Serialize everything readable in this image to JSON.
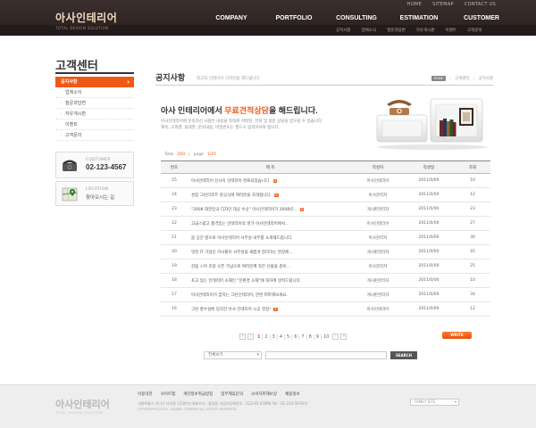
{
  "header": {
    "top_links": [
      "HOME",
      "SITEMAP",
      "CONTACT US"
    ],
    "logo": "아사인테리어",
    "logo_sub": "TOTAL DESIGN SOLUTION",
    "gnb": [
      "COMPANY",
      "PORTFOLIO",
      "CONSULTING",
      "ESTIMATION",
      "CUSTOMER"
    ],
    "subnav": [
      "공지사항",
      "업체소식",
      "질문과답변",
      "자유게시판",
      "이벤트",
      "고객문의"
    ]
  },
  "sidebar": {
    "title": "고객센터",
    "items": [
      {
        "label": "공지사항",
        "active": true
      },
      {
        "label": "업체소식",
        "active": false
      },
      {
        "label": "질문과답변",
        "active": false
      },
      {
        "label": "자유게시판",
        "active": false
      },
      {
        "label": "이벤트",
        "active": false
      },
      {
        "label": "고객문의",
        "active": false
      }
    ],
    "cs_label": "CUSTOMER",
    "cs_number": "02-123-4567",
    "location_label": "LOCATION",
    "location_text": "찾아오시는 길"
  },
  "main": {
    "page_title": "공지사항",
    "page_desc": "최고의 인테리어 디자인을 해드립니다.",
    "breadcrumb": [
      "HOME",
      "고객센터",
      "공지사항"
    ],
    "headline_pre": "아사 인테리어에서 ",
    "headline_hl": "무료견적상담",
    "headline_post": "을 해드립니다.",
    "intro_line1": "아사인테리어에 문의하신 사항은 내용을 토대로 어떠일, 전화 및 방문 상담을 받으실 수 있습니다.",
    "intro_line2": "제목, 고객명, 휴대폰, 문의내용, 비밀번호는 필드시 입력하셔야 합니다.",
    "total_label": "Total",
    "total_value": "200",
    "page_label": "page",
    "page_value": "1/25",
    "table": {
      "headers": [
        "번호",
        "제 목",
        "작성자",
        "작성일",
        "조회"
      ],
      "rows": [
        {
          "no": "25",
          "title": "아사인테리어 신사옥 인테리어 완료되었습니다.",
          "new": "N",
          "author": "아사인테리어",
          "date": "2011/0/00",
          "views": "10"
        },
        {
          "no": "24",
          "title": "성장 그린리조트 준공식에 여러분을 초대합니다.",
          "new": "N",
          "author": "아사관리자",
          "date": "2011/0/00",
          "views": "12"
        },
        {
          "no": "23",
          "title": "\"2008 대한민국 디자인 대상 수상\" 아사인테리어가 2008년...",
          "new": "N",
          "author": "게시판관리자",
          "date": "2011/0/00",
          "views": "23"
        },
        {
          "no": "22",
          "title": "고급스럽고 품격있는 인테리어의 명가 아사인테리어에서...",
          "new": "",
          "author": "아사인테리어",
          "date": "2011/0/00",
          "views": "27"
        },
        {
          "no": "21",
          "title": "봄 공간 향으로 아사인테리어 사무실 내부를 소개해드립니다.",
          "new": "",
          "author": "아사관리자",
          "date": "2011/0/00",
          "views": "30"
        },
        {
          "no": "20",
          "title": "멋진 IT 기업인 아사를이 사무실을 새롭게 정리하는 현장에...",
          "new": "",
          "author": "게시판관리자",
          "date": "2011/0/00",
          "views": "45"
        },
        {
          "no": "19",
          "title": "감립 스마 조랑 오픈 가넘으로 여러분께 작은 선물을 준비...",
          "new": "",
          "author": "아사관리자",
          "date": "2011/0/00",
          "views": "25"
        },
        {
          "no": "18",
          "title": "포고 있는 인테리어 소재인 \"친환경 소재\"에 대하여 알려드립니다.",
          "new": "",
          "author": "게시판관리자",
          "date": "2011/0/00",
          "views": "10"
        },
        {
          "no": "17",
          "title": "아사인테리어가 꿈하는 그런인테리어, 한번 피파해보세요.",
          "new": "",
          "author": "게시판관리자",
          "date": "2011/0/00",
          "views": "34"
        },
        {
          "no": "16",
          "title": "그런 풍수설에 입각한 아사 인테리어 시공 현장!",
          "new": "N",
          "author": "아사인테리어",
          "date": "2011/0/00",
          "views": "12"
        }
      ]
    },
    "pagination": {
      "prev_first": "«",
      "prev": "‹",
      "pages": [
        "1",
        "2",
        "3",
        "4",
        "5",
        "6",
        "7",
        "8",
        "9",
        "10"
      ],
      "current": "1",
      "next": "›",
      "next_last": "»"
    },
    "write_button": "WRITE",
    "search": {
      "select_value": "전체보기",
      "button": "SEARCH"
    }
  },
  "footer": {
    "logo": "아사인테리어",
    "logo_sub": "TOTAL DESIGN SOLUTION",
    "links": [
      "이용약관",
      "사이트맵",
      "개인정보취급방침",
      "업무제휴문의",
      "소비자피해보상",
      "채용정보"
    ],
    "address": "서울특별시 가나구 다라동 123번지  대표이사 : 홍길동   사업자등록번호 : 123-45-67890   Tel : 01-234-5678-9",
    "copyright": "COPYRIGHT(C)2011. ASABEE COMPANY ALL RIGHTS RESERVED.",
    "family_site": "FAMILY SITE"
  },
  "colors": {
    "accent": "#ee5a16",
    "header_bg": "#2f2523"
  }
}
